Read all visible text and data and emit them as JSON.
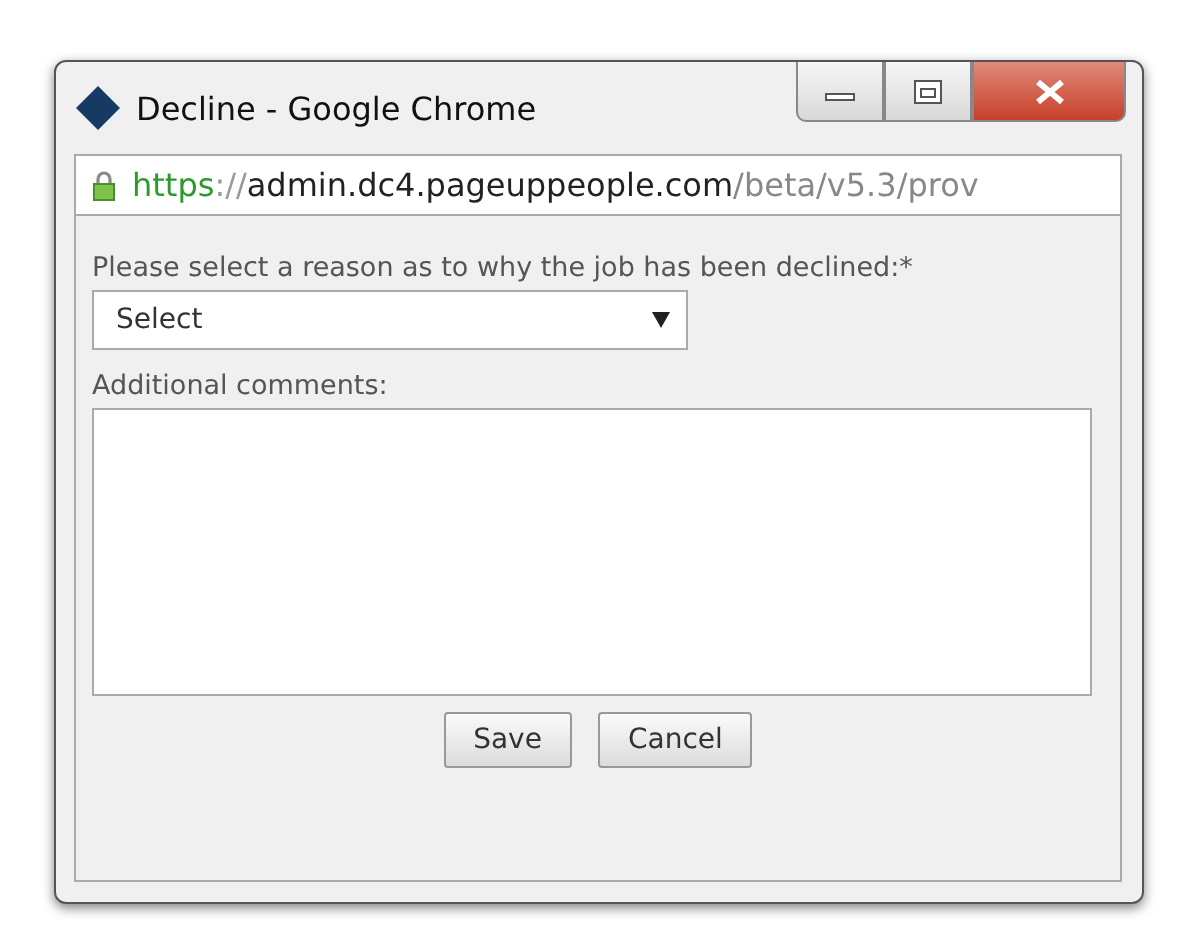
{
  "window": {
    "title": "Decline - Google Chrome"
  },
  "address_bar": {
    "secure": true,
    "parts": [
      {
        "kind": "scheme",
        "text": "https"
      },
      {
        "kind": "separator",
        "text": "://"
      },
      {
        "kind": "host",
        "text": "admin.dc4.pageuppeople.com"
      },
      {
        "kind": "path",
        "text": "/beta/v5.3/prov"
      }
    ]
  },
  "form": {
    "reason_label": "Please select a reason as to why the job has been declined:*",
    "reason_select": {
      "value": "Select"
    },
    "comments_label": "Additional comments:"
  },
  "buttons": [
    {
      "label": "Save"
    },
    {
      "label": "Cancel"
    }
  ]
}
